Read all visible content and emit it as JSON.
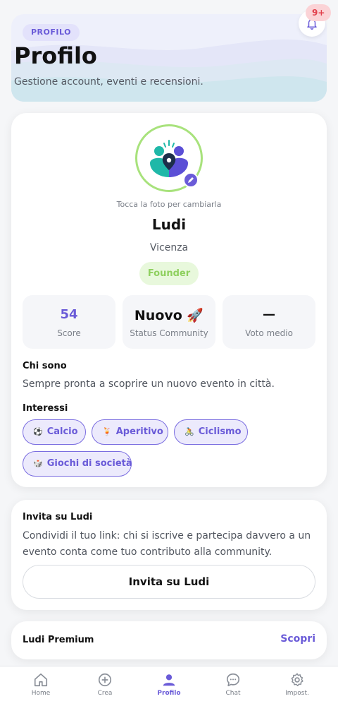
{
  "header": {
    "badge": "PROFILO",
    "title": "Profilo",
    "subtitle": "Gestione account, eventi e recensioni.",
    "notification_count": "9+"
  },
  "profile": {
    "photo_hint": "Tocca la foto per cambiarla",
    "name": "Ludi",
    "city": "Vicenza",
    "role_badge": "Founder",
    "stats": [
      {
        "value": "54",
        "label": "Score"
      },
      {
        "value": "Nuovo 🚀",
        "label": "Status Community"
      },
      {
        "value": "—",
        "label": "Voto medio"
      }
    ],
    "about_title": "Chi sono",
    "about_text": "Sempre pronta a scoprire un nuovo evento in città.",
    "interests_title": "Interessi",
    "interests": [
      {
        "emoji": "⚽",
        "label": "Calcio"
      },
      {
        "emoji": "🍹",
        "label": "Aperitivo"
      },
      {
        "emoji": "🚴",
        "label": "Ciclismo"
      },
      {
        "emoji": "🎲",
        "label": "Giochi di società"
      }
    ]
  },
  "invite": {
    "title": "Invita su Ludi",
    "text": "Condividi il tuo link: chi si iscrive e partecipa davvero a un evento conta come tuo contributo alla community.",
    "button": "Invita su Ludi"
  },
  "premium": {
    "title": "Ludi Premium",
    "link": "Scopri"
  },
  "nav": [
    {
      "label": "Home",
      "icon": "home-icon"
    },
    {
      "label": "Crea",
      "icon": "plus-circle-icon"
    },
    {
      "label": "Profilo",
      "icon": "user-icon"
    },
    {
      "label": "Chat",
      "icon": "chat-icon"
    },
    {
      "label": "Impost.",
      "icon": "gear-icon"
    }
  ],
  "colors": {
    "accent": "#6a5bd8",
    "founder_bg": "#e8f8dc",
    "founder_text": "#8fd05f",
    "badge_red": "#e2404c"
  }
}
